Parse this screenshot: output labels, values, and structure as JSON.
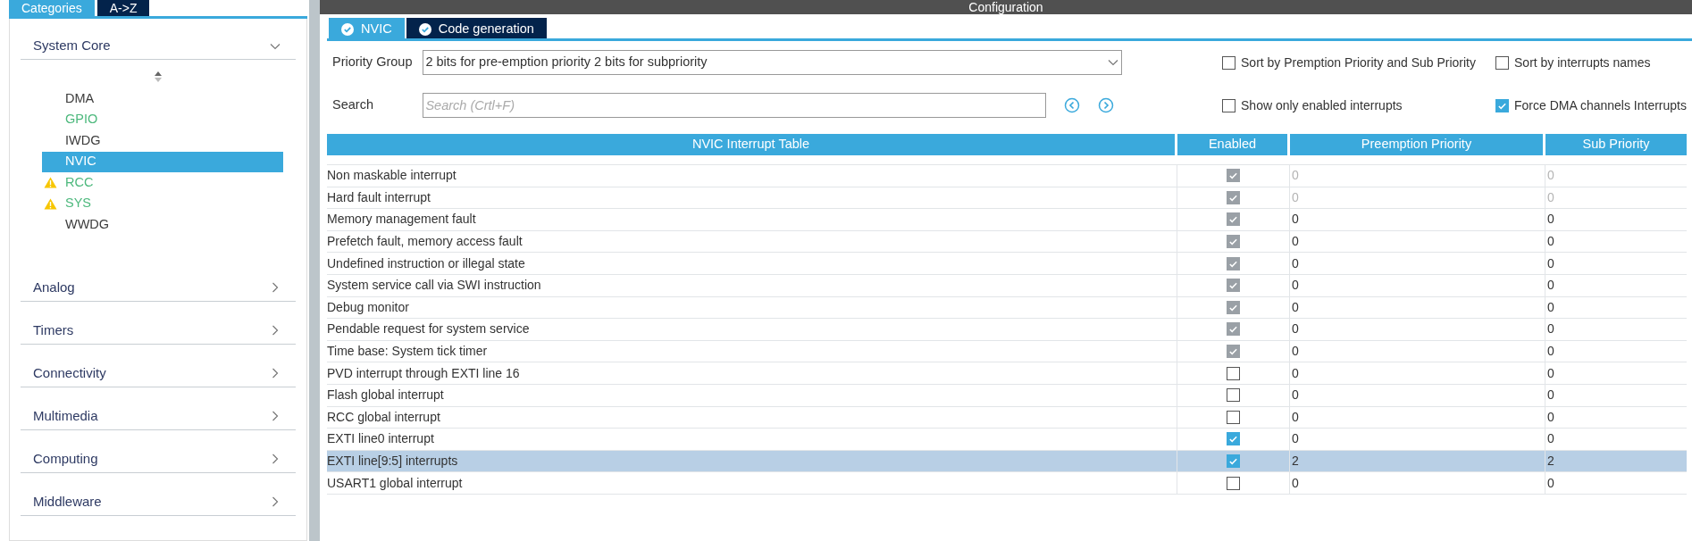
{
  "left_tabs": [
    {
      "label": "Categories",
      "selected": true
    },
    {
      "label": "A->Z",
      "selected": false
    }
  ],
  "category": {
    "title": "System Core",
    "expanded": true,
    "items": [
      {
        "label": "DMA",
        "color": "#3c3c3c",
        "warning": false,
        "selected": false
      },
      {
        "label": "GPIO",
        "color": "#4cb87c",
        "warning": false,
        "selected": false
      },
      {
        "label": "IWDG",
        "color": "#3c3c3c",
        "warning": false,
        "selected": false
      },
      {
        "label": "NVIC",
        "warning": false,
        "selected": true
      },
      {
        "label": "RCC",
        "color": "#4cb87c",
        "warning": true,
        "selected": false
      },
      {
        "label": "SYS",
        "color": "#4cb87c",
        "warning": true,
        "selected": false
      },
      {
        "label": "WWDG",
        "color": "#3c3c3c",
        "warning": false,
        "selected": false
      }
    ]
  },
  "other_categories": [
    {
      "title": "Analog",
      "expanded": false
    },
    {
      "title": "Timers",
      "expanded": false
    },
    {
      "title": "Connectivity",
      "expanded": false
    },
    {
      "title": "Multimedia",
      "expanded": false
    },
    {
      "title": "Computing",
      "expanded": false
    },
    {
      "title": "Middleware",
      "expanded": false
    }
  ],
  "config_title": "Configuration",
  "tabs": [
    {
      "label": "NVIC",
      "selected": true
    },
    {
      "label": "Code generation",
      "selected": false
    }
  ],
  "priority_group": {
    "label": "Priority Group",
    "value": "2 bits for pre-emption priority 2 bits for subpriority"
  },
  "search": {
    "label": "Search",
    "placeholder": "Search (Crtl+F)"
  },
  "options": [
    {
      "label": "Sort by Premption Priority and Sub Priority",
      "checked": false
    },
    {
      "label": "Sort by interrupts names",
      "checked": false
    },
    {
      "label": "Show only enabled interrupts",
      "checked": false
    },
    {
      "label": "Force DMA channels Interrupts",
      "checked": true
    }
  ],
  "table": {
    "columns": [
      "NVIC Interrupt Table",
      "Enabled",
      "Preemption Priority",
      "Sub Priority"
    ],
    "rows": [
      {
        "name": "Non maskable interrupt",
        "enabled": true,
        "locked": true,
        "values_disabled": true,
        "preemption": "0",
        "sub": "0",
        "selected": false
      },
      {
        "name": "Hard fault interrupt",
        "enabled": true,
        "locked": true,
        "values_disabled": true,
        "preemption": "0",
        "sub": "0",
        "selected": false
      },
      {
        "name": "Memory management fault",
        "enabled": true,
        "locked": true,
        "values_disabled": false,
        "preemption": "0",
        "sub": "0",
        "selected": false
      },
      {
        "name": "Prefetch fault, memory access fault",
        "enabled": true,
        "locked": true,
        "values_disabled": false,
        "preemption": "0",
        "sub": "0",
        "selected": false
      },
      {
        "name": "Undefined instruction or illegal state",
        "enabled": true,
        "locked": true,
        "values_disabled": false,
        "preemption": "0",
        "sub": "0",
        "selected": false
      },
      {
        "name": "System service call via SWI instruction",
        "enabled": true,
        "locked": true,
        "values_disabled": false,
        "preemption": "0",
        "sub": "0",
        "selected": false
      },
      {
        "name": "Debug monitor",
        "enabled": true,
        "locked": true,
        "values_disabled": false,
        "preemption": "0",
        "sub": "0",
        "selected": false
      },
      {
        "name": "Pendable request for system service",
        "enabled": true,
        "locked": true,
        "values_disabled": false,
        "preemption": "0",
        "sub": "0",
        "selected": false
      },
      {
        "name": "Time base: System tick timer",
        "enabled": true,
        "locked": true,
        "values_disabled": false,
        "preemption": "0",
        "sub": "0",
        "selected": false
      },
      {
        "name": "PVD interrupt through EXTI line 16",
        "enabled": false,
        "locked": false,
        "values_disabled": false,
        "preemption": "0",
        "sub": "0",
        "selected": false
      },
      {
        "name": "Flash global interrupt",
        "enabled": false,
        "locked": false,
        "values_disabled": false,
        "preemption": "0",
        "sub": "0",
        "selected": false
      },
      {
        "name": "RCC global interrupt",
        "enabled": false,
        "locked": false,
        "values_disabled": false,
        "preemption": "0",
        "sub": "0",
        "selected": false
      },
      {
        "name": "EXTI line0 interrupt",
        "enabled": true,
        "locked": false,
        "values_disabled": false,
        "preemption": "0",
        "sub": "0",
        "selected": false
      },
      {
        "name": "EXTI line[9:5] interrupts",
        "enabled": true,
        "locked": false,
        "values_disabled": false,
        "preemption": "2",
        "sub": "2",
        "selected": true
      },
      {
        "name": "USART1 global interrupt",
        "enabled": false,
        "locked": false,
        "values_disabled": false,
        "preemption": "0",
        "sub": "0",
        "selected": false
      }
    ]
  }
}
